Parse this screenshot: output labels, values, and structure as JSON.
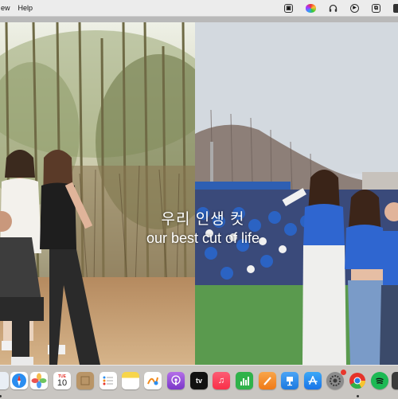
{
  "menubar": {
    "items": [
      "ew",
      "Help"
    ],
    "status_icons": [
      "screen-record-icon",
      "color-wheel-icon",
      "headphones-icon",
      "play-icon",
      "screen-mirror-icon",
      "battery-icon"
    ]
  },
  "overlay": {
    "korean_text": "우리 인생 컷",
    "english_text": "our best cut of life"
  },
  "dock": {
    "apps": [
      {
        "name": "finder-icon",
        "color": "#2f7de1"
      },
      {
        "name": "safari-icon",
        "color": "#2a8df0"
      },
      {
        "name": "photos-icon",
        "color": "#ffffff"
      },
      {
        "name": "calendar-icon",
        "color": "#ffffff",
        "label": "10",
        "sub": "TUE"
      },
      {
        "name": "notes-icon",
        "color": "#b99567"
      },
      {
        "name": "reminders-icon",
        "color": "#ffffff"
      },
      {
        "name": "stickies-icon",
        "color": "#f7d54a"
      },
      {
        "name": "freeform-icon",
        "color": "#ffffff"
      },
      {
        "name": "podcasts-icon",
        "color": "#9b4de0"
      },
      {
        "name": "apple-tv-icon",
        "color": "#111111",
        "label": "tv"
      },
      {
        "name": "music-icon",
        "color": "#fa3050"
      },
      {
        "name": "numbers-icon",
        "color": "#2fb24a"
      },
      {
        "name": "pages-icon",
        "color": "#f28a1c"
      },
      {
        "name": "keynote-icon",
        "color": "#2d8ef2"
      },
      {
        "name": "app-store-icon",
        "color": "#1f8ff5"
      },
      {
        "name": "system-settings-icon",
        "color": "#8c8c8c"
      },
      {
        "name": "chrome-icon",
        "color": "#ffffff"
      },
      {
        "name": "spotify-icon",
        "color": "#1db954"
      },
      {
        "name": "extra-app-icon",
        "color": "#3a3a3a"
      }
    ]
  }
}
